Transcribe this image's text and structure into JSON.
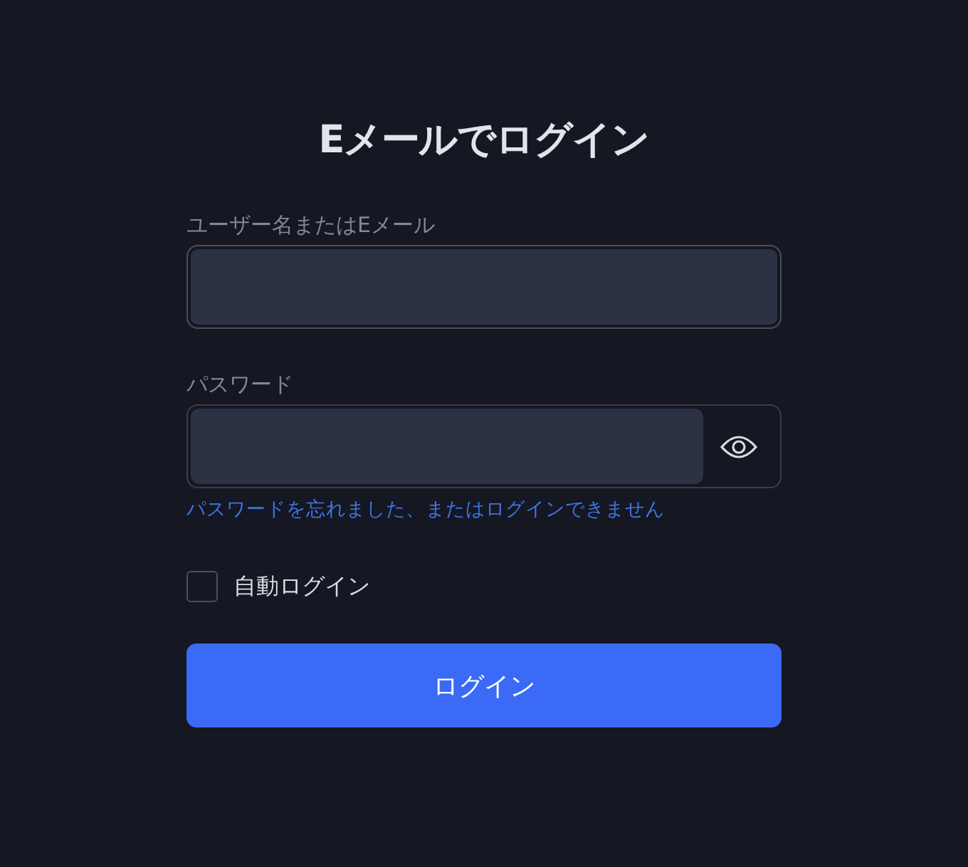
{
  "title": "Eメールでログイン",
  "username": {
    "label": "ユーザー名またはEメール"
  },
  "password": {
    "label": "パスワード",
    "visible": false
  },
  "forgot_link": "パスワードを忘れました、またはログインできません",
  "auto_login": {
    "label": "自動ログイン",
    "checked": false
  },
  "submit": "ログイン"
}
